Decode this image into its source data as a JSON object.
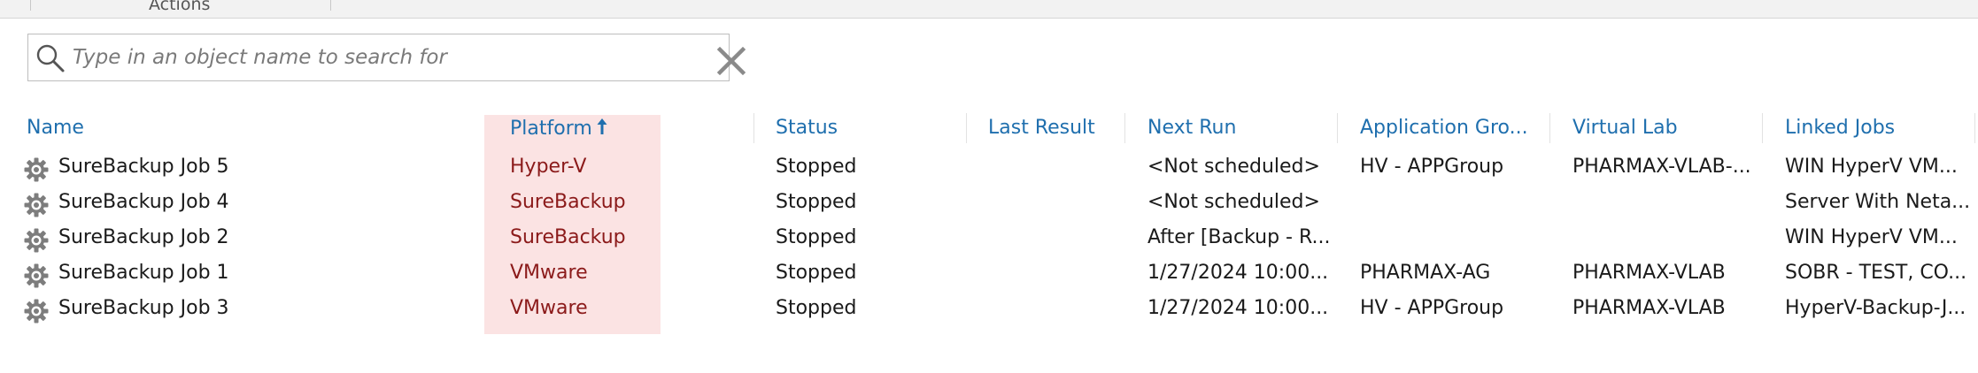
{
  "ribbon": {
    "group_label": "Actions"
  },
  "search": {
    "placeholder": "Type in an object name to search for",
    "value": ""
  },
  "columns": [
    {
      "key": "name",
      "label": "Name"
    },
    {
      "key": "platform",
      "label": "Platform",
      "sorted": "ascending"
    },
    {
      "key": "status",
      "label": "Status"
    },
    {
      "key": "last_result",
      "label": "Last Result"
    },
    {
      "key": "next_run",
      "label": "Next Run"
    },
    {
      "key": "application_group",
      "label": "Application Gro..."
    },
    {
      "key": "virtual_lab",
      "label": "Virtual Lab"
    },
    {
      "key": "linked_jobs",
      "label": "Linked Jobs"
    }
  ],
  "rows": [
    {
      "icon": "gear-icon",
      "name": "SureBackup Job 5",
      "platform": "Hyper-V",
      "status": "Stopped",
      "last_result": "",
      "next_run": "<Not scheduled>",
      "application_group": "HV - APPGroup",
      "virtual_lab": "PHARMAX-VLAB-...",
      "linked_jobs": "WIN HyperV VM..."
    },
    {
      "icon": "gear-icon",
      "name": "SureBackup Job 4",
      "platform": "SureBackup",
      "status": "Stopped",
      "last_result": "",
      "next_run": "<Not scheduled>",
      "application_group": "",
      "virtual_lab": "",
      "linked_jobs": "Server With Neta..."
    },
    {
      "icon": "gear-icon",
      "name": "SureBackup Job 2",
      "platform": "SureBackup",
      "status": "Stopped",
      "last_result": "",
      "next_run": "After [Backup - R...",
      "application_group": "",
      "virtual_lab": "",
      "linked_jobs": "WIN HyperV VM..."
    },
    {
      "icon": "gear-icon",
      "name": "SureBackup Job 1",
      "platform": "VMware",
      "status": "Stopped",
      "last_result": "",
      "next_run": "1/27/2024  10:00...",
      "application_group": "PHARMAX-AG",
      "virtual_lab": "PHARMAX-VLAB",
      "linked_jobs": "SOBR - TEST, CO..."
    },
    {
      "icon": "gear-icon",
      "name": "SureBackup Job 3",
      "platform": "VMware",
      "status": "Stopped",
      "last_result": "",
      "next_run": "1/27/2024  10:00...",
      "application_group": "HV - APPGroup",
      "virtual_lab": "PHARMAX-VLAB",
      "linked_jobs": "HyperV-Backup-J..."
    }
  ],
  "colors": {
    "header_text": "#1f6fae",
    "platform_text": "#8b1a1a",
    "sort_highlight": "#fbe3e3"
  }
}
